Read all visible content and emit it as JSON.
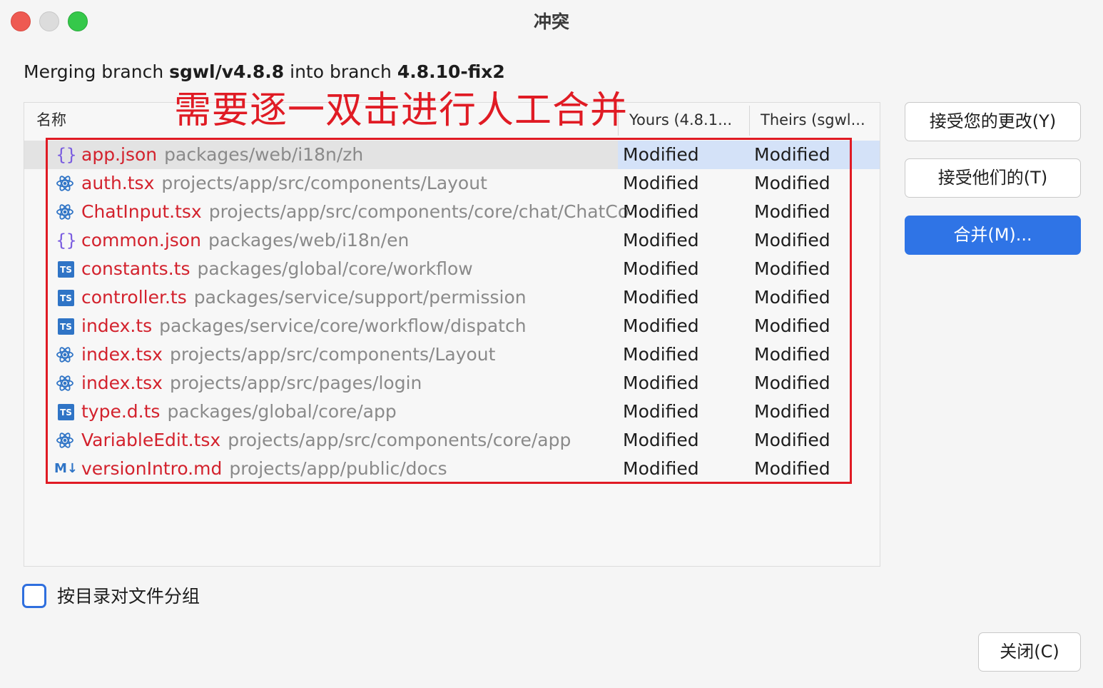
{
  "window": {
    "title": "冲突"
  },
  "merge_info": {
    "prefix": "Merging branch ",
    "source_branch": "sgwl/v4.8.8",
    "middle": " into branch ",
    "target_branch": "4.8.10-fix2"
  },
  "table": {
    "headers": {
      "name": "名称",
      "yours": "Yours (4.8.1...",
      "theirs": "Theirs (sgwl..."
    },
    "rows": [
      {
        "icon": "json-icon",
        "name": "app.json",
        "path": "packages/web/i18n/zh",
        "yours": "Modified",
        "theirs": "Modified",
        "selected": true
      },
      {
        "icon": "react-icon",
        "name": "auth.tsx",
        "path": "projects/app/src/components/Layout",
        "yours": "Modified",
        "theirs": "Modified"
      },
      {
        "icon": "react-icon",
        "name": "ChatInput.tsx",
        "path": "projects/app/src/components/core/chat/ChatCo",
        "yours": "Modified",
        "theirs": "Modified"
      },
      {
        "icon": "json-icon",
        "name": "common.json",
        "path": "packages/web/i18n/en",
        "yours": "Modified",
        "theirs": "Modified"
      },
      {
        "icon": "ts-icon",
        "name": "constants.ts",
        "path": "packages/global/core/workflow",
        "yours": "Modified",
        "theirs": "Modified"
      },
      {
        "icon": "ts-icon",
        "name": "controller.ts",
        "path": "packages/service/support/permission",
        "yours": "Modified",
        "theirs": "Modified"
      },
      {
        "icon": "ts-icon",
        "name": "index.ts",
        "path": "packages/service/core/workflow/dispatch",
        "yours": "Modified",
        "theirs": "Modified"
      },
      {
        "icon": "react-icon",
        "name": "index.tsx",
        "path": "projects/app/src/components/Layout",
        "yours": "Modified",
        "theirs": "Modified"
      },
      {
        "icon": "react-icon",
        "name": "index.tsx",
        "path": "projects/app/src/pages/login",
        "yours": "Modified",
        "theirs": "Modified"
      },
      {
        "icon": "ts-icon",
        "name": "type.d.ts",
        "path": "packages/global/core/app",
        "yours": "Modified",
        "theirs": "Modified"
      },
      {
        "icon": "react-icon",
        "name": "VariableEdit.tsx",
        "path": "projects/app/src/components/core/app",
        "yours": "Modified",
        "theirs": "Modified"
      },
      {
        "icon": "markdown-icon",
        "name": "versionIntro.md",
        "path": "projects/app/public/docs",
        "yours": "Modified",
        "theirs": "Modified"
      }
    ]
  },
  "icon_labels": {
    "ts": "TS",
    "json": "{}",
    "markdown": "M↓"
  },
  "annotation": {
    "text": "需要逐一双击进行人工合并",
    "color": "#e01b24"
  },
  "buttons": {
    "accept_yours": "接受您的更改(Y)",
    "accept_theirs": "接受他们的(T)",
    "merge": "合并(M)...",
    "close": "关闭(C)"
  },
  "group_by_directory": {
    "label": "按目录对文件分组",
    "checked": false
  },
  "colors": {
    "accent": "#2f74e6",
    "file_name": "#d3222d",
    "path": "#8a8a8a",
    "selected_row": "#d4e2f8"
  }
}
